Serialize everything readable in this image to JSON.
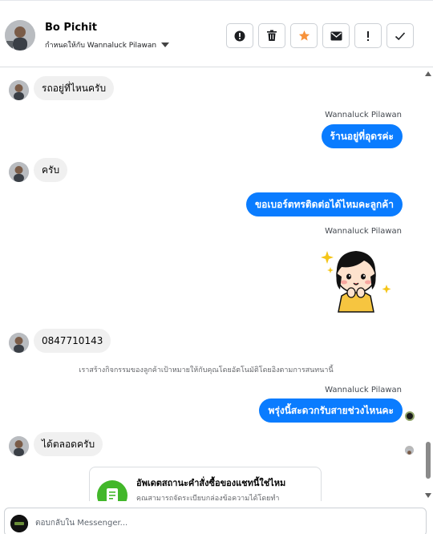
{
  "header": {
    "contact_name": "Bo Pichit",
    "assigned_to": "กำหนดให้กับ Wannaluck Pilawan",
    "actions": [
      {
        "icon": "alert-circle-icon",
        "label": "!"
      },
      {
        "icon": "trash-icon",
        "label": ""
      },
      {
        "icon": "star-icon",
        "label": ""
      },
      {
        "icon": "mail-icon",
        "label": ""
      },
      {
        "icon": "exclamation-icon",
        "label": "!"
      },
      {
        "icon": "check-icon",
        "label": ""
      }
    ]
  },
  "thread": {
    "messages": [
      {
        "direction": "in",
        "text": "รถอยู่ที่ไหนครับ"
      },
      {
        "direction": "out",
        "sender": "Wannaluck Pilawan",
        "text": "ร้านอยู่ที่อุดรค่ะ"
      },
      {
        "direction": "in",
        "text": "ครับ"
      },
      {
        "direction": "out",
        "text": "ขอเบอร์ตทรติดต่อได้ไหมคะลูกค้า"
      },
      {
        "direction": "out",
        "sender": "Wannaluck Pilawan",
        "type": "sticker"
      },
      {
        "direction": "in",
        "text": "0847710143"
      },
      {
        "direction": "system",
        "text": "เราสร้างกิจกรรมของลูกค้าเป้าหมายให้กับคุณโดยอัตโนมัติโดยอิงตามการสนทนานี้"
      },
      {
        "direction": "out",
        "sender": "Wannaluck Pilawan",
        "text": "พรุ่งนี้สะดวกรับสายช่วงไหนคะ"
      },
      {
        "direction": "in",
        "text": "ได้ตลอดครับ"
      }
    ],
    "card": {
      "title": "อัพเดตสถานะคำสั่งซื้อของแชทนี้ใช่ไหม",
      "description": "คุณสามารถจัดระเบียบกล่องข้อความได้โดยทำ"
    }
  },
  "composer": {
    "placeholder": "ตอบกลับใน Messenger..."
  },
  "colors": {
    "outgoing_bubble": "#0a7cff",
    "incoming_bubble": "#f0f0f0",
    "star": "#f7923a",
    "card_icon": "#42b72a"
  }
}
